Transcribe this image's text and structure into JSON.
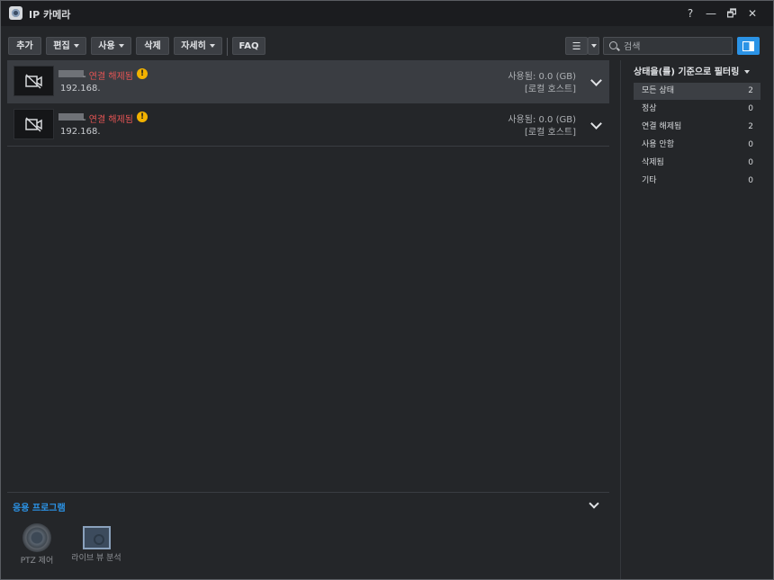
{
  "window": {
    "title": "IP 카메라",
    "help": "?",
    "minimize": "—",
    "restore": "🗗",
    "close": "✕"
  },
  "toolbar": {
    "add": "추가",
    "edit": "편집",
    "enable": "사용",
    "delete": "삭제",
    "details": "자세히",
    "faq": "FAQ",
    "list_view_icon": "☰"
  },
  "search": {
    "placeholder": "검색"
  },
  "cameras": [
    {
      "status": "연결 해제됨",
      "dash": "- ",
      "warn": "!",
      "ip": "192.168.",
      "usage": "사용됨: 0.0 (GB)",
      "host": "[로컬 호스트]"
    },
    {
      "status": "연결 해제됨",
      "dash": "- ",
      "warn": "!",
      "ip": "192.168.",
      "usage": "사용됨: 0.0 (GB)",
      "host": "[로컬 호스트]"
    }
  ],
  "apps": {
    "title": "응용 프로그램",
    "items": [
      {
        "label": "PTZ 제어",
        "icon": "ptz-icon"
      },
      {
        "label": "라이브 뷰 분석",
        "icon": "live-view-analytics-icon"
      }
    ]
  },
  "filter": {
    "title": "상태을(를) 기준으로 필터링",
    "items": [
      {
        "label": "모든 상태",
        "count": "2"
      },
      {
        "label": "정상",
        "count": "0"
      },
      {
        "label": "연결 해제됨",
        "count": "2"
      },
      {
        "label": "사용 안함",
        "count": "0"
      },
      {
        "label": "삭제됨",
        "count": "0"
      },
      {
        "label": "기타",
        "count": "0"
      }
    ]
  },
  "colors": {
    "accent": "#2b93e6",
    "error": "#e25454",
    "warning": "#f2b200"
  }
}
